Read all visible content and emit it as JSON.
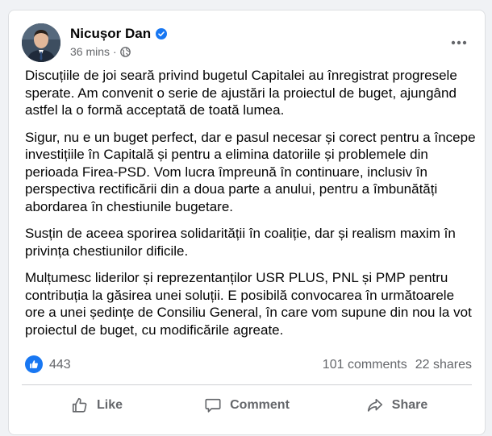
{
  "post": {
    "author": "Nicușor Dan",
    "time": "36 mins",
    "paragraphs": [
      "Discuțiile de joi seară privind bugetul Capitalei au înregistrat progresele sperate. Am convenit o serie de ajustări la proiectul de buget, ajungând astfel la o formă acceptată de toată lumea.",
      "Sigur, nu e un buget perfect, dar e pasul necesar și corect pentru a începe investițiile în Capitală și pentru a elimina datoriile și problemele din perioada Firea-PSD. Vom lucra împreună în continuare, inclusiv în perspectiva rectificării din a doua parte a anului, pentru a îmbunătăți abordarea în chestiunile bugetare.",
      "Susțin de aceea sporirea solidarității în coaliție, dar și realism maxim în privința chestiunilor dificile.",
      "Mulțumesc liderilor și reprezentanților USR PLUS, PNL și PMP pentru contribuția la găsirea unei soluții. E posibilă convocarea în următoarele ore a unei ședințe de Consiliu General, în care vom supune din nou la vot proiectul de buget, cu modificările agreate."
    ]
  },
  "stats": {
    "reactions": "443",
    "comments": "101 comments",
    "shares": "22 shares"
  },
  "actions": {
    "like": "Like",
    "comment": "Comment",
    "share": "Share"
  },
  "icons": {
    "verified": "verified-badge-icon",
    "privacy": "globe-icon",
    "more": "more-dots-icon",
    "reaction": "like-reaction-icon",
    "like": "thumbs-up-icon",
    "comment": "comment-bubble-icon",
    "share": "share-arrow-icon"
  },
  "colors": {
    "accent": "#1877f2",
    "secondary_text": "#65676b",
    "primary_text": "#050505",
    "background": "#f0f2f5"
  }
}
